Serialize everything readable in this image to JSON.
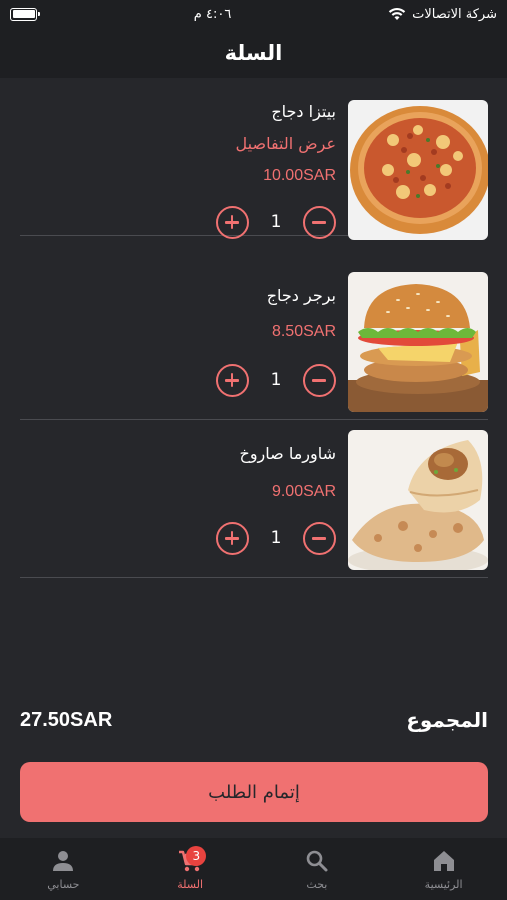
{
  "status_bar": {
    "carrier": "شركة الاتصالات",
    "time": "٤:٠٦ م",
    "battery_level": 1.0
  },
  "header": {
    "title": "السلة"
  },
  "cart": {
    "items": [
      {
        "name": "بيتزا دجاج",
        "details": "عرض التفاصيل",
        "price": "10.00SAR",
        "quantity": "1",
        "image": "chicken-pizza"
      },
      {
        "name": "برجر دجاج",
        "details": "",
        "price": "8.50SAR",
        "quantity": "1",
        "image": "chicken-burger"
      },
      {
        "name": "شاورما صاروخ",
        "details": "",
        "price": "9.00SAR",
        "quantity": "1",
        "image": "shawarma-wrap"
      }
    ]
  },
  "total": {
    "label": "المجموع",
    "value": "27.50SAR"
  },
  "checkout": {
    "label": "إتمام الطلب"
  },
  "tab_bar": {
    "tabs": [
      {
        "label": "حسابي",
        "icon": "person-icon"
      },
      {
        "label": "السلة",
        "icon": "cart-icon",
        "badge": "3",
        "active": true
      },
      {
        "label": "بحث",
        "icon": "search-icon"
      },
      {
        "label": "الرئيسية",
        "icon": "home-icon"
      }
    ]
  },
  "colors": {
    "accent": "#f07171",
    "background": "#26272b",
    "bar_background": "#1e1f22",
    "badge": "#e8433f"
  }
}
